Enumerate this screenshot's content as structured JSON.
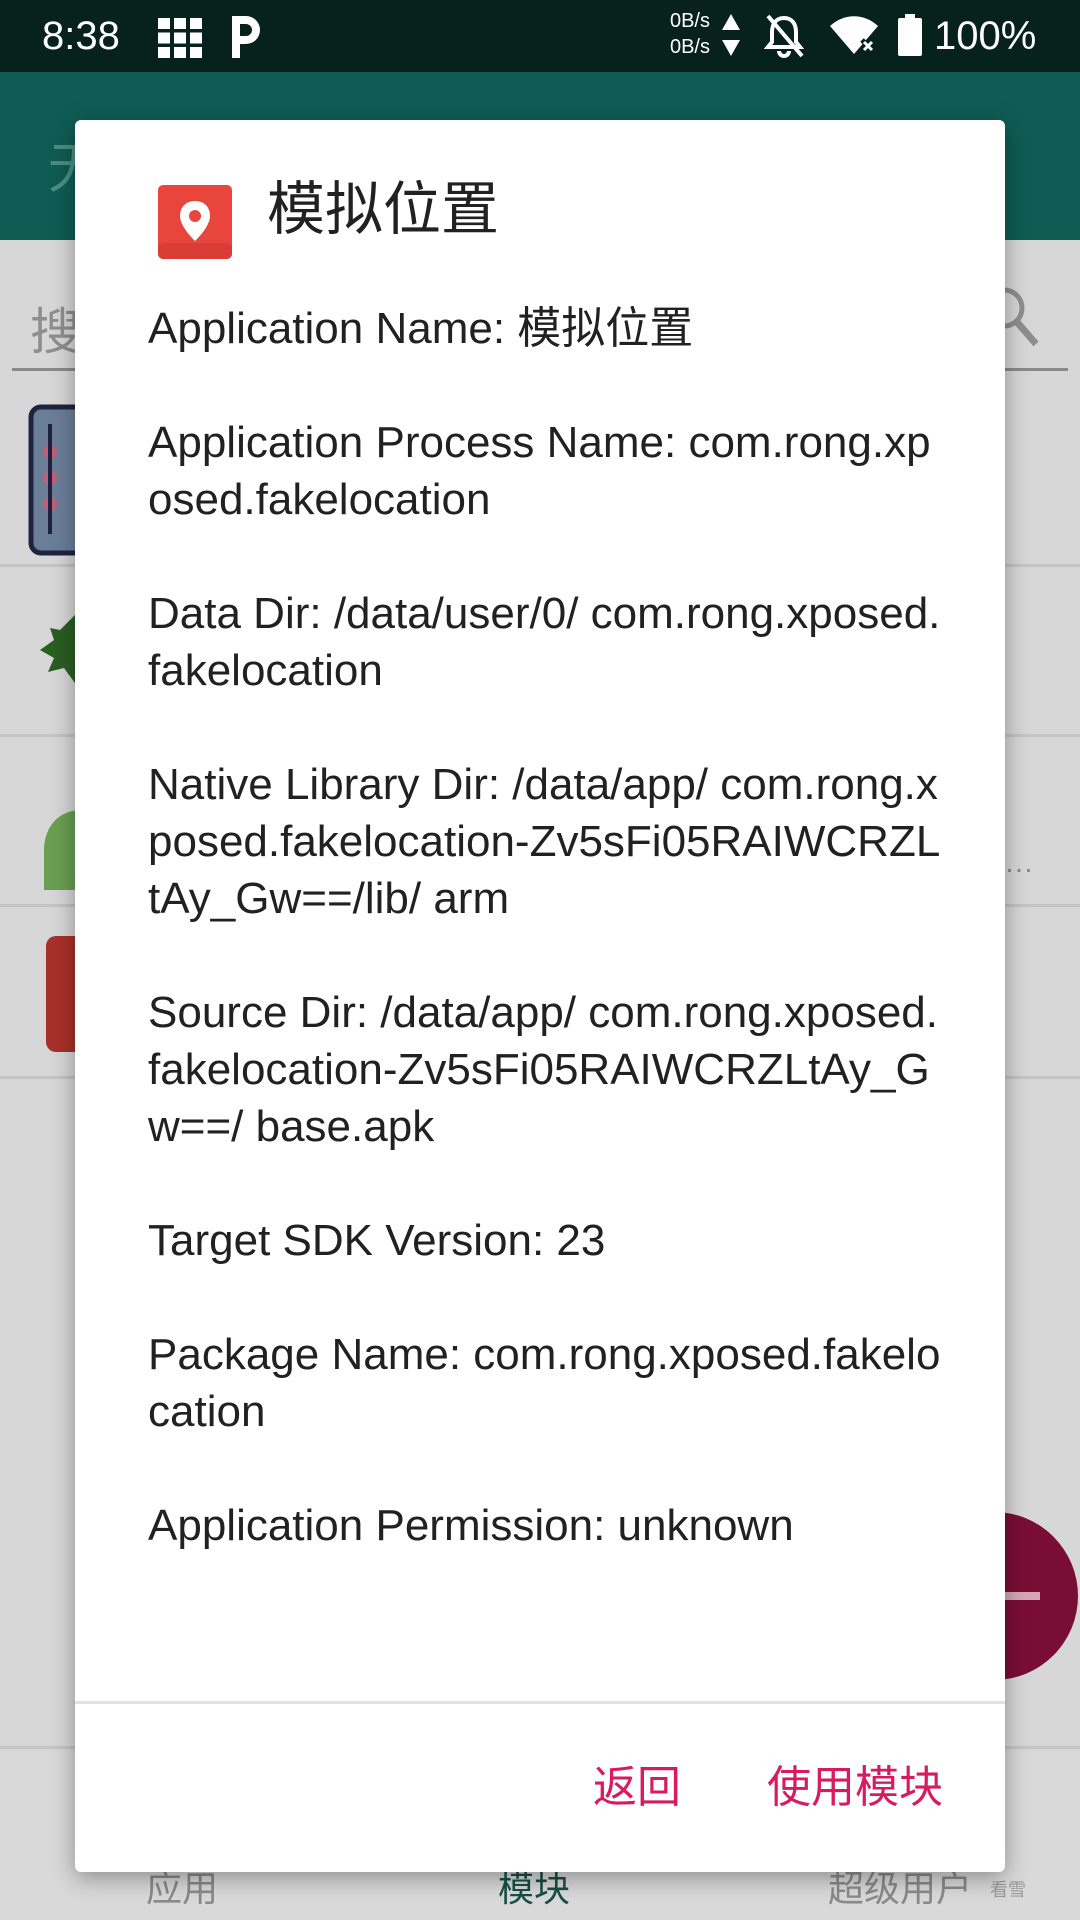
{
  "status_bar": {
    "time": "8:38",
    "net_speed_up": "0B/s",
    "net_speed_down": "0B/s",
    "battery": "100%",
    "icons": [
      "grid-icon",
      "parking-icon",
      "updown-arrows-icon",
      "bell-off-icon",
      "wifi-icon",
      "battery-icon"
    ]
  },
  "background_app": {
    "title_partial": "无",
    "search_hint_partial": "搜",
    "ellipsis": "…",
    "bottom_nav": [
      "应用",
      "模块",
      "超级用户"
    ],
    "watermark": "看雪"
  },
  "dialog": {
    "icon": "location-pin-icon",
    "title": "模拟位置",
    "info": [
      "Application Name: 模拟位置",
      "Application Process Name: com.rong.xposed.fakelocation",
      "Data Dir: /data/user/0/ com.rong.xposed.fakelocation",
      "Native Library Dir: /data/app/ com.rong.xposed.fakelocation-Zv5sFi05RAIWCRZLtAy_Gw==/lib/ arm",
      "Source Dir: /data/app/ com.rong.xposed.fakelocation-Zv5sFi05RAIWCRZLtAy_Gw==/ base.apk",
      "Target SDK Version: 23",
      "Package Name: com.rong.xposed.fakelocation",
      "Application Permission: unknown"
    ],
    "buttons": {
      "back": "返回",
      "use_module": "使用模块"
    }
  },
  "colors": {
    "status_bar": "#07211d",
    "app_bar": "#0f5c54",
    "accent": "#d81b60",
    "icon_red": "#e8453c"
  }
}
